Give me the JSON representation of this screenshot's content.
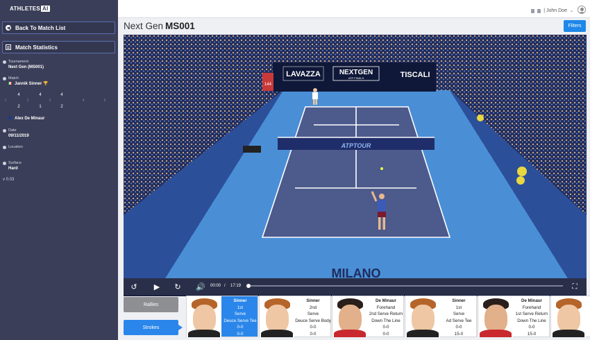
{
  "app": {
    "logo_text": "ATHLETES",
    "logo_badge": "AI",
    "version": "v 0.03"
  },
  "sidebar": {
    "back_label": "Back To Match List",
    "stats_label": "Match Statistics",
    "tournament_label": "Tournament",
    "tournament_value": "Next Gen (MS001)",
    "match_label": "Match",
    "player1": "Jannik Sinner",
    "player2": "Alex De Minaur",
    "score_top": [
      "4",
      "4",
      "4"
    ],
    "score_mid": [
      "1",
      "2",
      "3",
      "4",
      "5"
    ],
    "score_bottom": [
      "2",
      "1",
      "2"
    ],
    "date_label": "Date",
    "date_value": "09/11/2019",
    "location_label": "Location",
    "surface_label": "Surface",
    "surface_value": "Hard"
  },
  "topbar": {
    "user": "| John Doe"
  },
  "header": {
    "event": "Next Gen",
    "code": "MS001",
    "filters_label": "Filters"
  },
  "video": {
    "boards": [
      "LAVAZZA",
      "NEXTGEN",
      "ATP FINALS",
      "TISCALI",
      "ATPTOUR",
      "MILANO",
      "144"
    ],
    "current_time": "00:00",
    "separator": "/",
    "duration": "17:19",
    "progress": 0
  },
  "tabs": {
    "rallies": "Rallies",
    "strokes": "Strokes"
  },
  "strokes": [
    {
      "player": "Sinner",
      "l1": "1st",
      "l2": "Serve",
      "l3": "Deuce Serve Tee",
      "l4": "0-0",
      "l5": "0-0",
      "active": true
    },
    {
      "player": "Sinner",
      "l1": "2nd",
      "l2": "Serve",
      "l3": "Deuce Serve Body",
      "l4": "0-0",
      "l5": "0-0",
      "active": false
    },
    {
      "player": "De Minaur",
      "l1": "Forehand",
      "l2": "2nd Serve Return",
      "l3": "Down The Line",
      "l4": "0-0",
      "l5": "0-0",
      "active": false
    },
    {
      "player": "Sinner",
      "l1": "1st",
      "l2": "Serve",
      "l3": "Ad Serve Tee",
      "l4": "0-0",
      "l5": "15-0",
      "active": false
    },
    {
      "player": "De Minaur",
      "l1": "Forehand",
      "l2": "1st Serve Return",
      "l3": "Down The Line",
      "l4": "0-0",
      "l5": "15-0",
      "active": false
    }
  ]
}
